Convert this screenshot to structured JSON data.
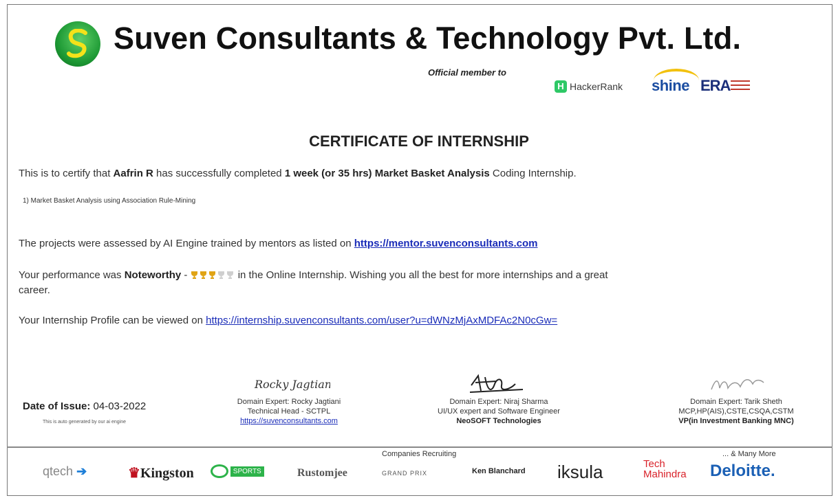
{
  "header": {
    "company_name": "Suven Consultants & Technology Pvt. Ltd.",
    "official_member": "Official member to",
    "partners": [
      "HackerRank",
      "shine",
      "ERA"
    ]
  },
  "certificate": {
    "title": "CERTIFICATE OF INTERNSHIP",
    "line1_a": "This is to certify that ",
    "name": "Aafrin R",
    "line1_b": " has successfully completed ",
    "duration_course": "1 week (or 35 hrs) Market Basket Analysis",
    "line1_c": " Coding Internship.",
    "project_item": "1) Market Basket Analysis using Association Rule-Mining",
    "assessed_text": "The projects were assessed by AI Engine trained by mentors as listed on ",
    "mentor_url": "https://mentor.suvenconsultants.com",
    "performance_a": "Your performance was ",
    "performance_rating": "Noteworthy",
    "performance_dash": " - ",
    "trophies_earned": 3,
    "trophies_total": 5,
    "performance_b": " in the Online Internship. Wishing you all the best for more internships and a great",
    "performance_c": "career.",
    "profile_text": "Your Internship Profile can be viewed on ",
    "profile_url": "https://internship.suvenconsultants.com/user?u=dWNzMjAxMDFAc2N0cGw="
  },
  "footer": {
    "date_label": "Date of Issue: ",
    "date_value": "04-03-2022",
    "auto_note": "This is auto generated by our ai engine",
    "signatories": [
      {
        "signature": "Rocky Jagtiani",
        "line1": "Domain Expert: Rocky Jagtiani",
        "line2": "Technical Head - SCTPL",
        "line3": "https://suvenconsultants.com"
      },
      {
        "signature": "Niraj",
        "line1": "Domain Expert: Niraj Sharma",
        "line2": "UI/UX expert and Software Engineer",
        "line3": "NeoSOFT Technologies"
      },
      {
        "signature": "Tarik Sheth",
        "line1": "Domain Expert: Tarik Sheth",
        "line2": "MCP,HP(AIS),CSTE,CSQA,CSTM",
        "line3": "VP(in Investment Banking MNC)"
      }
    ],
    "recruiting_label": "Companies Recruiting",
    "many_more": "... & Many More",
    "companies": [
      "qtech",
      "Kingston",
      "SPORTS",
      "Rustomjee",
      "GRAND PRIX",
      "Ken Blanchard",
      "iksula",
      "Tech Mahindra",
      "Deloitte."
    ]
  },
  "colors": {
    "link": "#1a2cb8",
    "trophy_gold": "#e0a416",
    "trophy_grey": "#cfcfcf",
    "logo_green": "#1e9a35"
  }
}
